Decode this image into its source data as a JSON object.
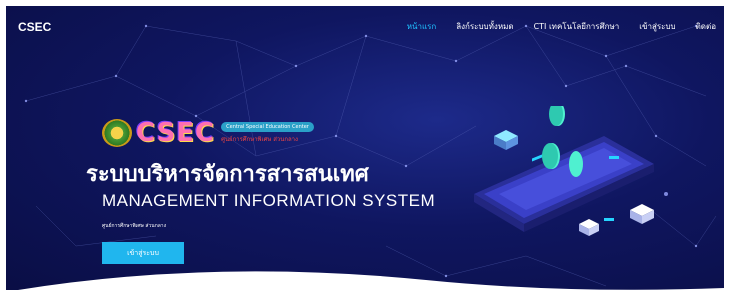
{
  "brand": "CSEC",
  "nav": {
    "items": [
      {
        "label": "หน้าแรก",
        "active": true
      },
      {
        "label": "ลิงก์ระบบทั้งหมด",
        "active": false
      },
      {
        "label": "CTI เทคโนโลยีการศึกษา",
        "active": false
      },
      {
        "label": "เข้าสู่ระบบ",
        "active": false
      },
      {
        "label": "ติดต่อ",
        "active": false
      }
    ]
  },
  "hero": {
    "logo_letters": "CSEC",
    "logo_en": "Central Special Education Center",
    "logo_th": "ศูนย์การศึกษาพิเศษ ส่วนกลาง",
    "title_th": "ระบบบริหารจัดการสารสนเทศ",
    "title_en": "MANAGEMENT INFORMATION SYSTEM",
    "tagline": "ศูนย์การศึกษาพิเศษ ส่วนกลาง",
    "cta_label": "เข้าสู่ระบบ"
  },
  "colors": {
    "background": "#0f1660",
    "accent": "#20b6ee",
    "active_nav": "#1fc1ff"
  }
}
